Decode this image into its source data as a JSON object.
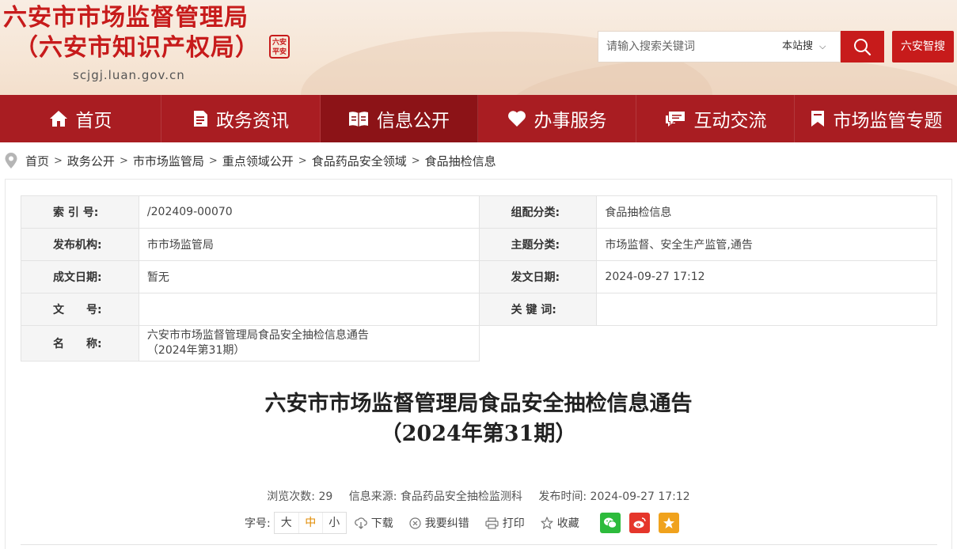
{
  "header": {
    "title_line1": "六安市市场监督管理局",
    "title_line2": "（六安市知识产权局）",
    "domain": "scjgj.luan.gov.cn",
    "seal_text": "六安\n平安",
    "search": {
      "placeholder": "请输入搜索关键词",
      "scope": "本站搜",
      "button_icon": "search-icon"
    },
    "smart_search_label": "六安智搜",
    "colors": {
      "brand_red": "#c71b1b",
      "nav_red": "#a91d22",
      "nav_active": "#8c1317"
    }
  },
  "nav": {
    "items": [
      {
        "label": "首页",
        "icon": "home-icon"
      },
      {
        "label": "政务资讯",
        "icon": "document-icon"
      },
      {
        "label": "信息公开",
        "icon": "open-book-icon",
        "active": true
      },
      {
        "label": "办事服务",
        "icon": "heart-icon"
      },
      {
        "label": "互动交流",
        "icon": "chat-icon"
      },
      {
        "label": "市场监管专题",
        "icon": "bookmark-icon"
      }
    ]
  },
  "breadcrumb": {
    "icon": "location-pin-icon",
    "items": [
      "首页",
      "政务公开",
      "市市场监管局",
      "重点领域公开",
      "食品药品安全领域",
      "食品抽检信息"
    ],
    "separator": ">"
  },
  "meta": {
    "index_label": "索 引 号:",
    "index_value": "/202409-00070",
    "category_label": "组配分类:",
    "category_value": "食品抽检信息",
    "publisher_label": "发布机构:",
    "publisher_value": "市市场监管局",
    "topic_label": "主题分类:",
    "topic_value": "市场监督、安全生产监管,通告",
    "created_label": "成文日期:",
    "created_value": "暂无",
    "issued_label": "发文日期:",
    "issued_value": "2024-09-27 17:12",
    "docno_label": "文　　号:",
    "docno_value": "",
    "keywords_label": "关 键 词:",
    "keywords_value": "",
    "name_label": "名　　称:",
    "name_value_line1": "六安市市场监督管理局食品安全抽检信息通告",
    "name_value_line2": "（2024年第31期）"
  },
  "article": {
    "title_line1": "六安市市场监督管理局食品安全抽检信息通告",
    "title_line2": "（2024年第31期）",
    "views_label": "浏览次数:",
    "views": "29",
    "source_label": "信息来源:",
    "source": "食品药品安全抽检监测科",
    "date_label": "发布时间:",
    "date": "2024-09-27 17:12"
  },
  "tools": {
    "fontsize_label": "字号:",
    "fontsize_large": "大",
    "fontsize_medium": "中",
    "fontsize_small": "小",
    "download": "下载",
    "correction": "我要纠错",
    "print": "打印",
    "favorite": "收藏",
    "share_icons": [
      "wechat-icon",
      "weibo-icon",
      "qzone-star-icon"
    ]
  }
}
